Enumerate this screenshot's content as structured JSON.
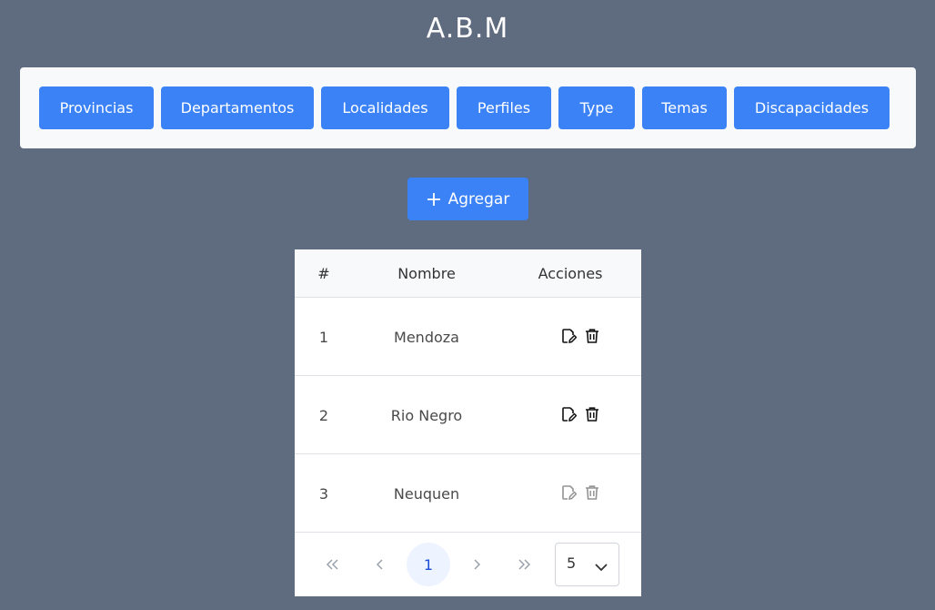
{
  "page": {
    "title": "A.B.M"
  },
  "nav": {
    "buttons": [
      {
        "label": "Provincias"
      },
      {
        "label": "Departamentos"
      },
      {
        "label": "Localidades"
      },
      {
        "label": "Perfiles"
      },
      {
        "label": "Type"
      },
      {
        "label": "Temas"
      },
      {
        "label": "Discapacidades"
      }
    ]
  },
  "toolbar": {
    "add_label": "Agregar",
    "add_icon": "plus-icon"
  },
  "table": {
    "columns": [
      "#",
      "Nombre",
      "Acciones"
    ],
    "rows": [
      {
        "id": "1",
        "name": "Mendoza",
        "enabled": true
      },
      {
        "id": "2",
        "name": "Rio Negro",
        "enabled": true
      },
      {
        "id": "3",
        "name": "Neuquen",
        "enabled": false
      }
    ],
    "row_actions": [
      "edit-icon",
      "trash-icon"
    ]
  },
  "pagination": {
    "current_page": "1",
    "rows_per_page": "5",
    "controls": [
      "first-page-icon",
      "prev-page-icon",
      "next-page-icon",
      "last-page-icon"
    ]
  },
  "colors": {
    "background": "#5f6b7f",
    "primary": "#3b82f6",
    "panel": "#f8f9fb",
    "active_page_bg": "#eef4ff",
    "active_page_text": "#1d4ed8"
  }
}
